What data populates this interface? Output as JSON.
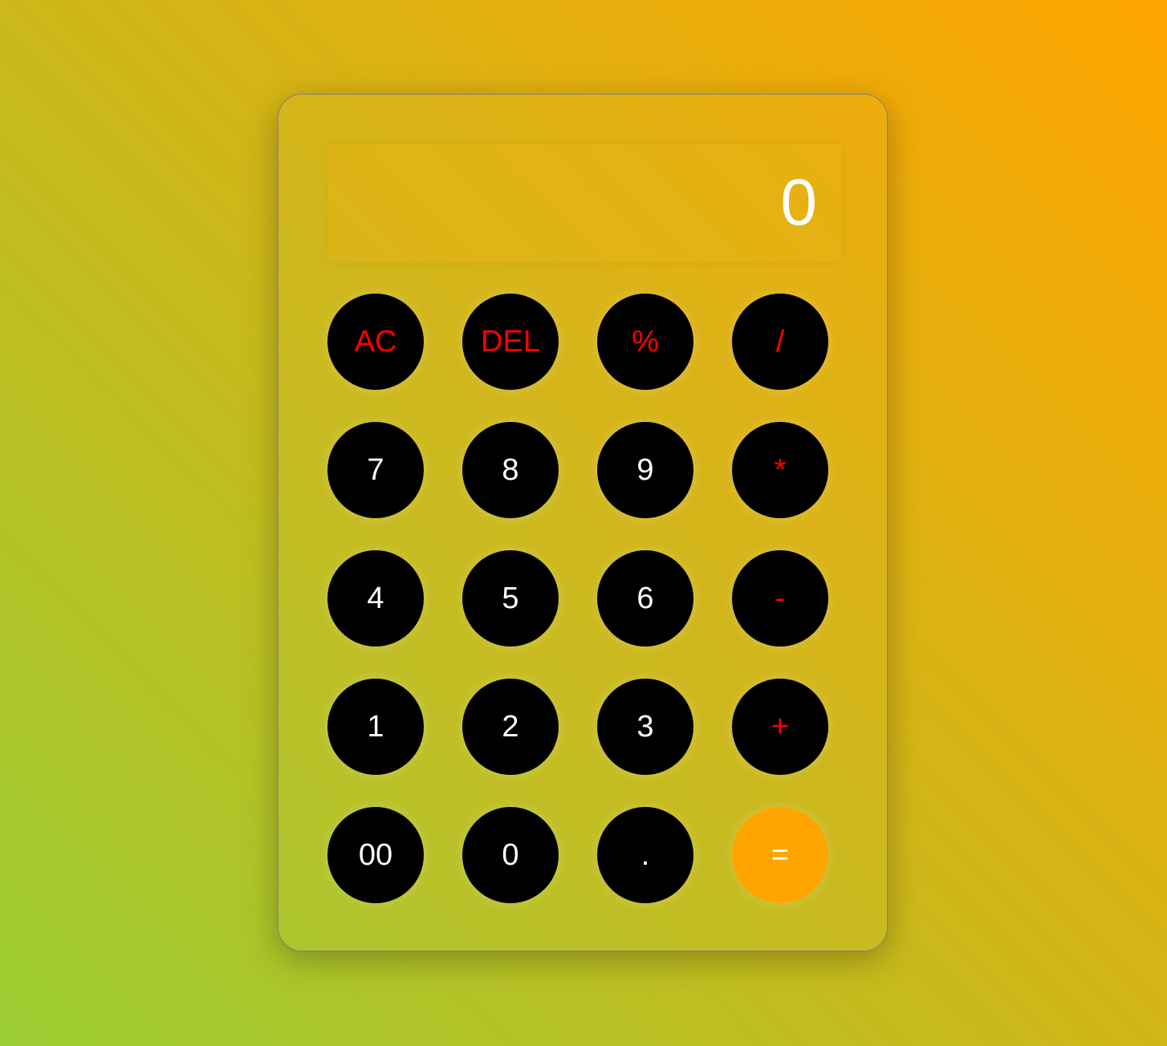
{
  "display": {
    "value": "0"
  },
  "keys": [
    {
      "label": "AC",
      "name": "all-clear-button",
      "kind": "op"
    },
    {
      "label": "DEL",
      "name": "delete-button",
      "kind": "op"
    },
    {
      "label": "%",
      "name": "percent-button",
      "kind": "op"
    },
    {
      "label": "/",
      "name": "divide-button",
      "kind": "op"
    },
    {
      "label": "7",
      "name": "digit-7-button",
      "kind": "num"
    },
    {
      "label": "8",
      "name": "digit-8-button",
      "kind": "num"
    },
    {
      "label": "9",
      "name": "digit-9-button",
      "kind": "num"
    },
    {
      "label": "*",
      "name": "multiply-button",
      "kind": "op"
    },
    {
      "label": "4",
      "name": "digit-4-button",
      "kind": "num"
    },
    {
      "label": "5",
      "name": "digit-5-button",
      "kind": "num"
    },
    {
      "label": "6",
      "name": "digit-6-button",
      "kind": "num"
    },
    {
      "label": "-",
      "name": "subtract-button",
      "kind": "op"
    },
    {
      "label": "1",
      "name": "digit-1-button",
      "kind": "num"
    },
    {
      "label": "2",
      "name": "digit-2-button",
      "kind": "num"
    },
    {
      "label": "3",
      "name": "digit-3-button",
      "kind": "num"
    },
    {
      "label": "+",
      "name": "add-button",
      "kind": "op"
    },
    {
      "label": "00",
      "name": "double-zero-button",
      "kind": "num"
    },
    {
      "label": "0",
      "name": "digit-0-button",
      "kind": "num"
    },
    {
      "label": ".",
      "name": "decimal-point-button",
      "kind": "num"
    },
    {
      "label": "=",
      "name": "equals-button",
      "kind": "equal"
    }
  ],
  "colors": {
    "key_background": "#000000",
    "operator_text": "#ff0000",
    "digit_text": "#ffffff",
    "equals_background": "#ffa500",
    "background_start": "#9acd32",
    "background_end": "#ffa500"
  }
}
